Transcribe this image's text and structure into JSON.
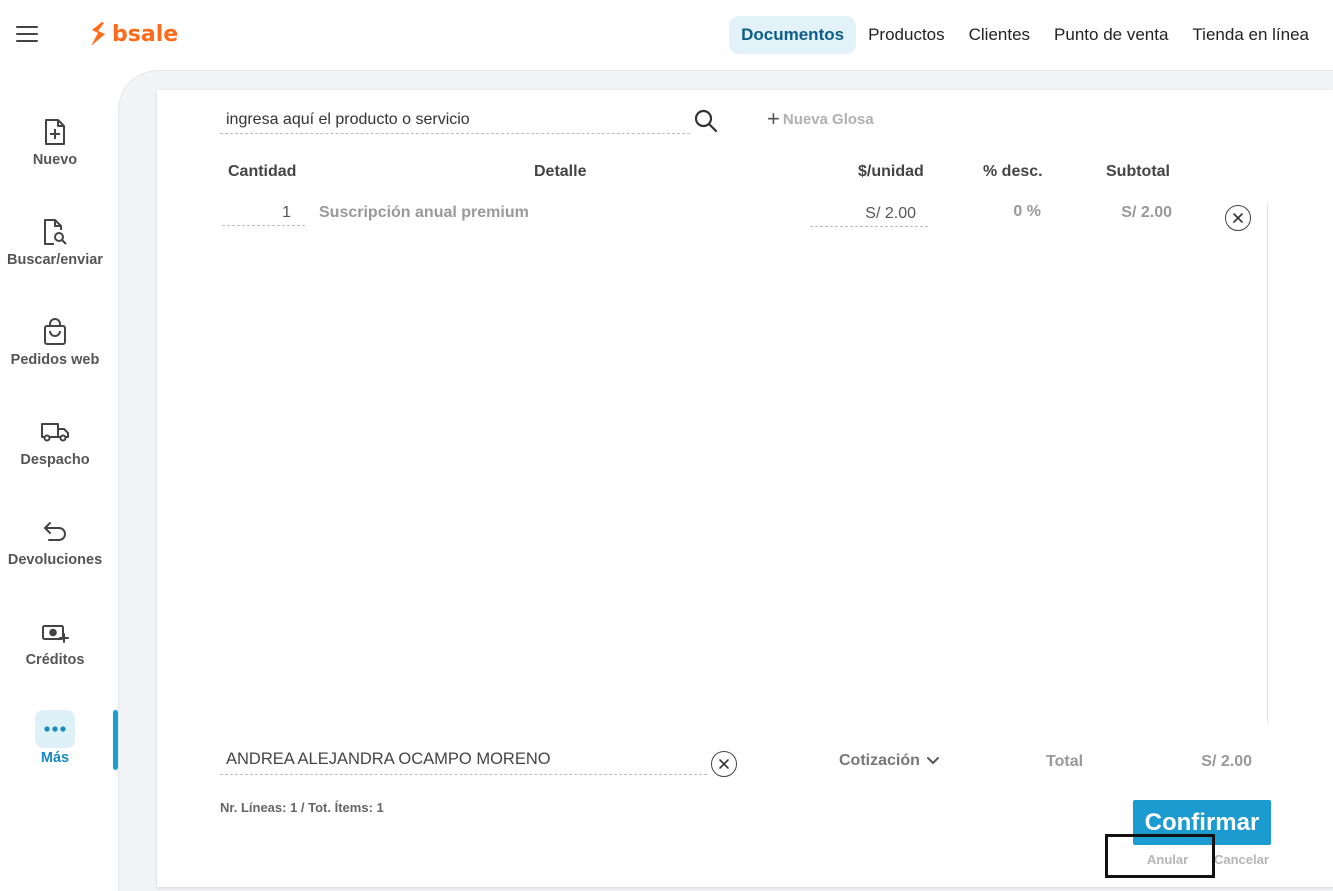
{
  "header": {
    "logo_text": "bsale",
    "brand_color": "#ff6b1a",
    "nav": [
      {
        "label": "Documentos",
        "active": true
      },
      {
        "label": "Productos",
        "active": false
      },
      {
        "label": "Clientes",
        "active": false
      },
      {
        "label": "Punto de venta",
        "active": false
      },
      {
        "label": "Tienda en línea",
        "active": false
      }
    ]
  },
  "sidebar": {
    "items": [
      {
        "label": "Nuevo",
        "icon": "new-document-icon"
      },
      {
        "label": "Buscar/enviar",
        "icon": "search-document-icon"
      },
      {
        "label": "Pedidos web",
        "icon": "shopping-bag-icon"
      },
      {
        "label": "Despacho",
        "icon": "truck-icon"
      },
      {
        "label": "Devoluciones",
        "icon": "return-arrow-icon"
      },
      {
        "label": "Créditos",
        "icon": "cash-plus-icon"
      },
      {
        "label": "Más",
        "icon": "more-dots-icon",
        "active": true
      }
    ],
    "accent_color": "#16a0d3"
  },
  "editor": {
    "search_placeholder": "ingresa aquí el producto o servicio",
    "nueva_glosa_label": "Nueva Glosa",
    "columns": {
      "cantidad": "Cantidad",
      "detalle": "Detalle",
      "unidad": "$/unidad",
      "desc": "% desc.",
      "subtotal": "Subtotal"
    },
    "rows": [
      {
        "cantidad": "1",
        "detalle": "Suscripción anual premium",
        "unidad": "S/ 2.00",
        "desc": "0 %",
        "subtotal": "S/ 2.00"
      }
    ]
  },
  "footer": {
    "client_name": "ANDREA ALEJANDRA OCAMPO MORENO",
    "doc_type": "Cotización",
    "total_label": "Total",
    "total_value": "S/ 2.00",
    "lines_info": "Nr. Líneas: 1 / Tot. Ítems: 1",
    "confirm_label": "Confirmar",
    "anular_label": "Anular",
    "cancelar_label": "Cancelar",
    "confirm_color": "#1b9bd0"
  }
}
